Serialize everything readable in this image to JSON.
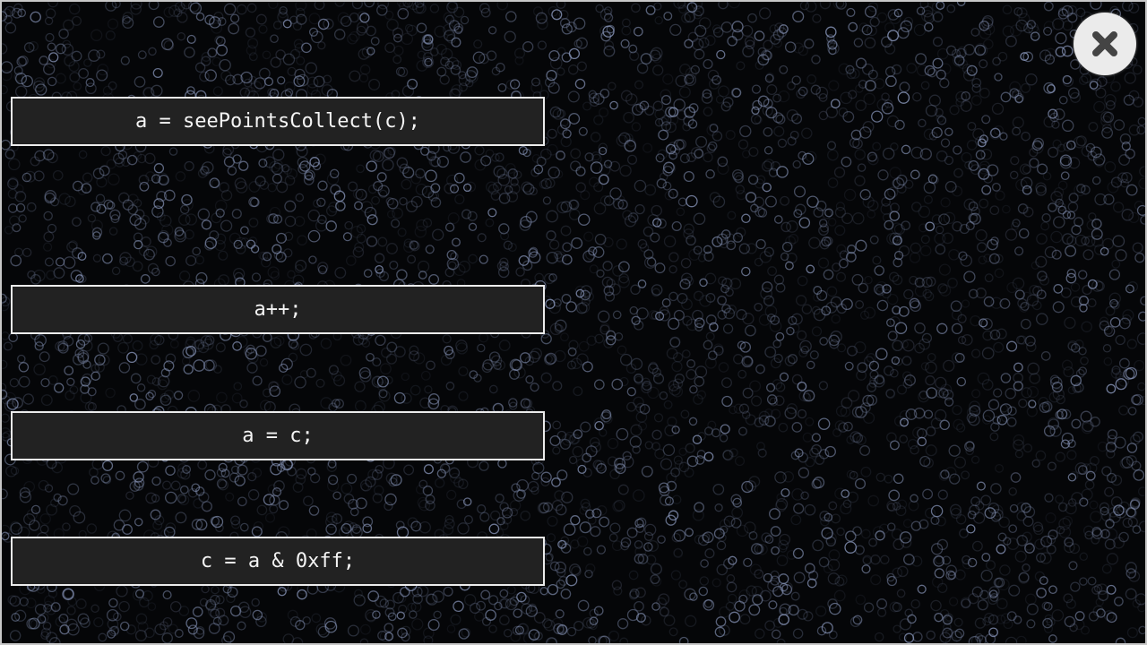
{
  "options": [
    {
      "code": "a = seePointsCollect(c);"
    },
    {
      "code": "a++;"
    },
    {
      "code": "a = c;"
    },
    {
      "code": "c = a & 0xff;"
    }
  ],
  "close_button": {
    "icon": "close-icon"
  },
  "colors": {
    "background": "#050608",
    "circle_stroke": "#8d9bc0",
    "option_fill": "#222222",
    "option_border": "#ececec",
    "option_text": "#f4f4f4",
    "close_fill": "#ebebeb",
    "close_icon": "#444444"
  }
}
